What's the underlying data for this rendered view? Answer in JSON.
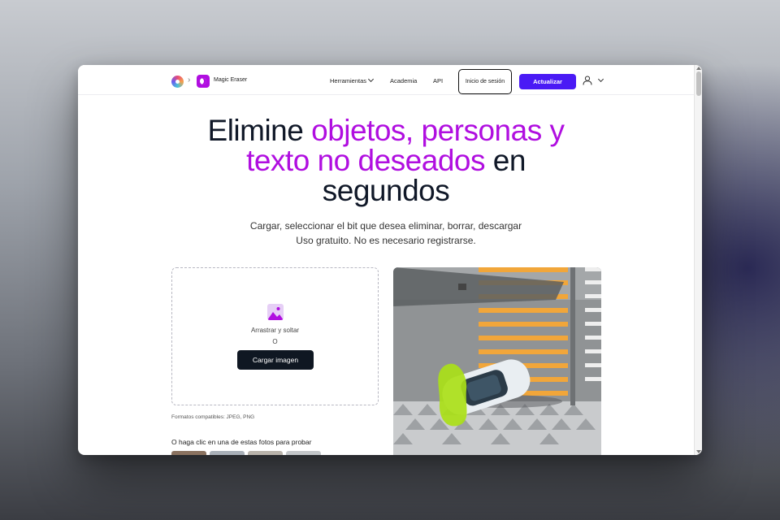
{
  "header": {
    "app_name": "Magic Eraser",
    "nav": [
      "Herramientas",
      "Academia",
      "API"
    ],
    "login_label": "Inicio de sesión",
    "upgrade_label": "Actualizar"
  },
  "hero": {
    "title_line1_plain": "Elimine ",
    "title_line1_accent": "objetos, personas y",
    "title_line2_accent": "texto no deseados",
    "title_line2_plain": " en",
    "title_line3": "segundos",
    "subtitle1": "Cargar, seleccionar el bit que desea eliminar, borrar, descargar",
    "subtitle2": "Uso gratuito. No es necesario registrarse."
  },
  "upload": {
    "drag_text": "Arrastrar y soltar",
    "or_text": "O",
    "button_label": "Cargar imagen",
    "formats_text": "Formatos compatibles: JPEG, PNG",
    "try_text": "O haga clic en una de estas fotos para probar"
  },
  "colors": {
    "accent": "#b00ee0",
    "primary": "#4a1af5",
    "dark": "#0f1722"
  }
}
